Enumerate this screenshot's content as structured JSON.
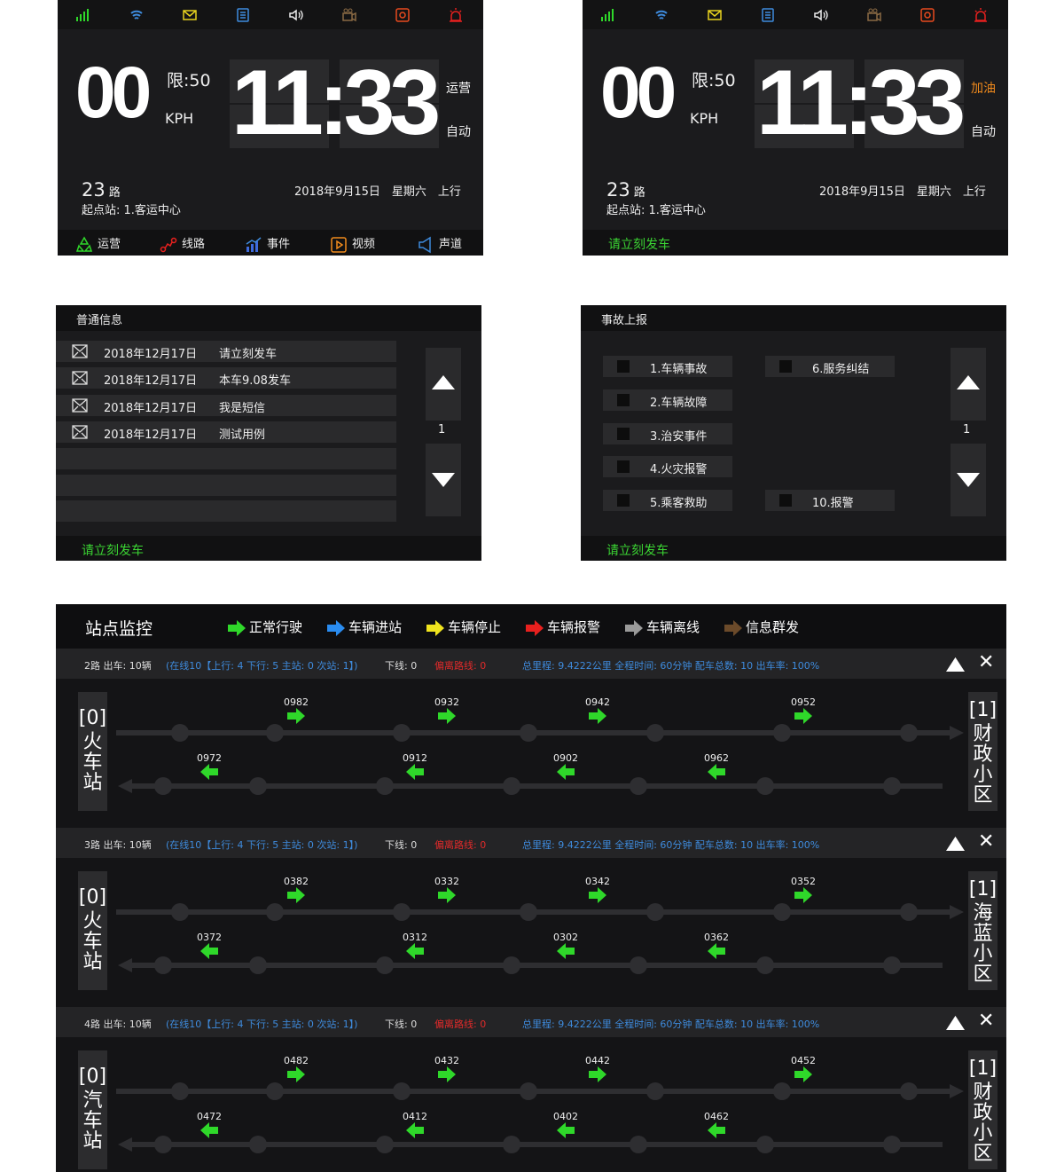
{
  "dash1": {
    "speed": "00",
    "limit": "限:50",
    "unit": "KPH",
    "clock_h": "11",
    "clock_sep": ":",
    "clock_m": "33",
    "mode1": "运营",
    "mode1_color": "#ffffff",
    "mode2": "自动",
    "route_num": "23",
    "route_suffix": "路",
    "origin": "起点站: 1.客运中心",
    "date": "2018年9月15日",
    "weekday": "星期六",
    "direction": "上行",
    "nav": [
      "运营",
      "线路",
      "事件",
      "视频",
      "声道"
    ]
  },
  "dash2": {
    "speed": "00",
    "limit": "限:50",
    "unit": "KPH",
    "clock_h": "11",
    "clock_sep": ":",
    "clock_m": "33",
    "mode1": "加油",
    "mode1_color": "#f08a1c",
    "mode2": "自动",
    "route_num": "23",
    "route_suffix": "路",
    "origin": "起点站: 1.客运中心",
    "date": "2018年9月15日",
    "weekday": "星期六",
    "direction": "上行",
    "message": "请立刻发车"
  },
  "messages": {
    "title": "普通信息",
    "rows": [
      {
        "date": "2018年12月17日",
        "text": "请立刻发车"
      },
      {
        "date": "2018年12月17日",
        "text": "本车9.08发车"
      },
      {
        "date": "2018年12月17日",
        "text": "我是短信"
      },
      {
        "date": "2018年12月17日",
        "text": "测试用例"
      }
    ],
    "page": "1",
    "footer": "请立刻发车"
  },
  "accident": {
    "title": "事故上报",
    "left": [
      "1.车辆事故",
      "2.车辆故障",
      "3.治安事件",
      "4.火灾报警",
      "5.乘客救助"
    ],
    "right_top": "6.服务纠结",
    "right_bottom": "10.报警",
    "page": "1",
    "footer": "请立刻发车"
  },
  "monitor": {
    "title": "站点监控",
    "legend": [
      {
        "label": "正常行驶",
        "color": "#2fd82a"
      },
      {
        "label": "车辆进站",
        "color": "#2a8cf0"
      },
      {
        "label": "车辆停止",
        "color": "#f0e41e"
      },
      {
        "label": "车辆报警",
        "color": "#e8201e"
      },
      {
        "label": "车辆离线",
        "color": "#9a9a9a"
      },
      {
        "label": "信息群发",
        "color": "#6b4a2a"
      }
    ],
    "routes": [
      {
        "info_route": "2路 出车: 10辆",
        "info_online": "(在线10【上行: 4 下行: 5 主站: 0 次站: 1】)",
        "info_offline": "下线: 0",
        "info_dev": "偏离路线: 0",
        "info_stats": "总里程: 9.4222公里   全程时间: 60分钟   配车总数: 10   出车率: 100%",
        "start_idx": "[0]",
        "start_name": "火车站",
        "end_idx": "[1]",
        "end_name": "财政小区",
        "up": [
          "0982",
          "0932",
          "0942",
          "0952"
        ],
        "down": [
          "0972",
          "0912",
          "0902",
          "0962"
        ]
      },
      {
        "info_route": "3路 出车: 10辆",
        "info_online": "(在线10【上行: 4 下行: 5 主站: 0 次站: 1】)",
        "info_offline": "下线: 0",
        "info_dev": "偏离路线: 0",
        "info_stats": "总里程: 9.4222公里   全程时间: 60分钟   配车总数: 10   出车率: 100%",
        "start_idx": "[0]",
        "start_name": "火车站",
        "end_idx": "[1]",
        "end_name": "海蓝小区",
        "up": [
          "0382",
          "0332",
          "0342",
          "0352"
        ],
        "down": [
          "0372",
          "0312",
          "0302",
          "0362"
        ]
      },
      {
        "info_route": "4路 出车: 10辆",
        "info_online": "(在线10【上行: 4 下行: 5 主站: 0 次站: 1】)",
        "info_offline": "下线: 0",
        "info_dev": "偏离路线: 0",
        "info_stats": "总里程: 9.4222公里   全程时间: 60分钟   配车总数: 10   出车率: 100%",
        "start_idx": "[0]",
        "start_name": "汽车站",
        "end_idx": "[1]",
        "end_name": "财政小区",
        "up": [
          "0482",
          "0432",
          "0442",
          "0452"
        ],
        "down": [
          "0472",
          "0412",
          "0402",
          "0462"
        ]
      }
    ]
  }
}
